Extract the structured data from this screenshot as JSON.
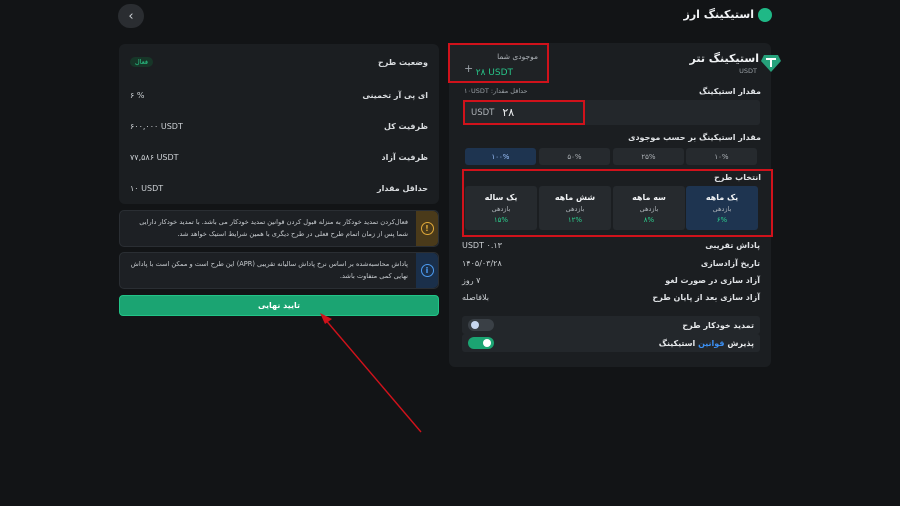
{
  "header": {
    "title": "استیکینگ ارز",
    "back_icon": "chevron-left-icon"
  },
  "coin": {
    "name": "استیکینگ تتر",
    "symbol": "USDT"
  },
  "balance": {
    "label": "موجودی شما",
    "value": "۲۸ USDT",
    "add_icon": "+"
  },
  "amount": {
    "label": "مقدار استیکینگ",
    "min_hint": "حداقل مقدار: ۱۰USDT",
    "unit": "USDT",
    "value": "۲۸"
  },
  "percent": {
    "label": "مقدار استیکینگ بر حسب موجودی",
    "options": [
      "۱۰%",
      "۲۵%",
      "۵۰%",
      "۱۰۰%"
    ],
    "selected": "۱۰۰%"
  },
  "plans": {
    "label": "انتخاب طرح",
    "items": [
      {
        "name": "یک ماهه",
        "type": "بازدهی",
        "rate": "۶%"
      },
      {
        "name": "سه ماهه",
        "type": "بازدهی",
        "rate": "۸%"
      },
      {
        "name": "شش ماهه",
        "type": "بازدهی",
        "rate": "۱۲%"
      },
      {
        "name": "یک ساله",
        "type": "بازدهی",
        "rate": "۱۵%"
      }
    ],
    "selected": "یک ماهه"
  },
  "details": [
    {
      "label": "پاداش تقریبی",
      "value": "۰.۱۳ USDT"
    },
    {
      "label": "تاریخ آزادسازی",
      "value": "۱۴۰۵/۰۳/۲۸"
    },
    {
      "label": "آزاد سازی در صورت لغو",
      "value": "۷ روز"
    },
    {
      "label": "آزاد سازی بعد از پایان طرح",
      "value": "بلافاصله"
    }
  ],
  "toggles": {
    "auto_renew": {
      "label": "تمدید خودکار طرح",
      "on": false
    },
    "accept": {
      "label_prefix": "پذیرش",
      "link": "قوانین",
      "label_suffix": "استیکینگ",
      "on": true
    }
  },
  "summary": [
    {
      "label": "وضعیت طرح",
      "value": "فعال",
      "badge": true
    },
    {
      "label": "ای پی آر تخمینی",
      "value": "۶ %"
    },
    {
      "label": "ظرفیت کل",
      "value": "۶۰۰,۰۰۰ USDT"
    },
    {
      "label": "ظرفیت آزاد",
      "value": "۷۷,۵۸۶ USDT"
    },
    {
      "label": "حداقل مقدار",
      "value": "۱۰ USDT"
    }
  ],
  "notices": [
    {
      "text": "فعال‌کردن تمدید خودکار به منزله قبول کردن قوانین تمدید خودکار می باشد. با تمدید خودکار دارایی شما پس از زمان اتمام طرح فعلی در طرح دیگری با همین شرایط استیک خواهد شد.",
      "icon": "warning-icon",
      "symbol": "!"
    },
    {
      "text": "پاداش محاسبه‌شده بر اساس نرخ پاداش سالیانه تقریبی (APR) این طرح است و ممکن است با پاداش نهایی کمی متفاوت باشد.",
      "icon": "info-icon",
      "symbol": "i"
    }
  ],
  "confirm": {
    "label": "تایید نهایی"
  },
  "colors": {
    "accent": "#1ba472",
    "highlight": "#d0121b",
    "selected": "#1e3450"
  }
}
